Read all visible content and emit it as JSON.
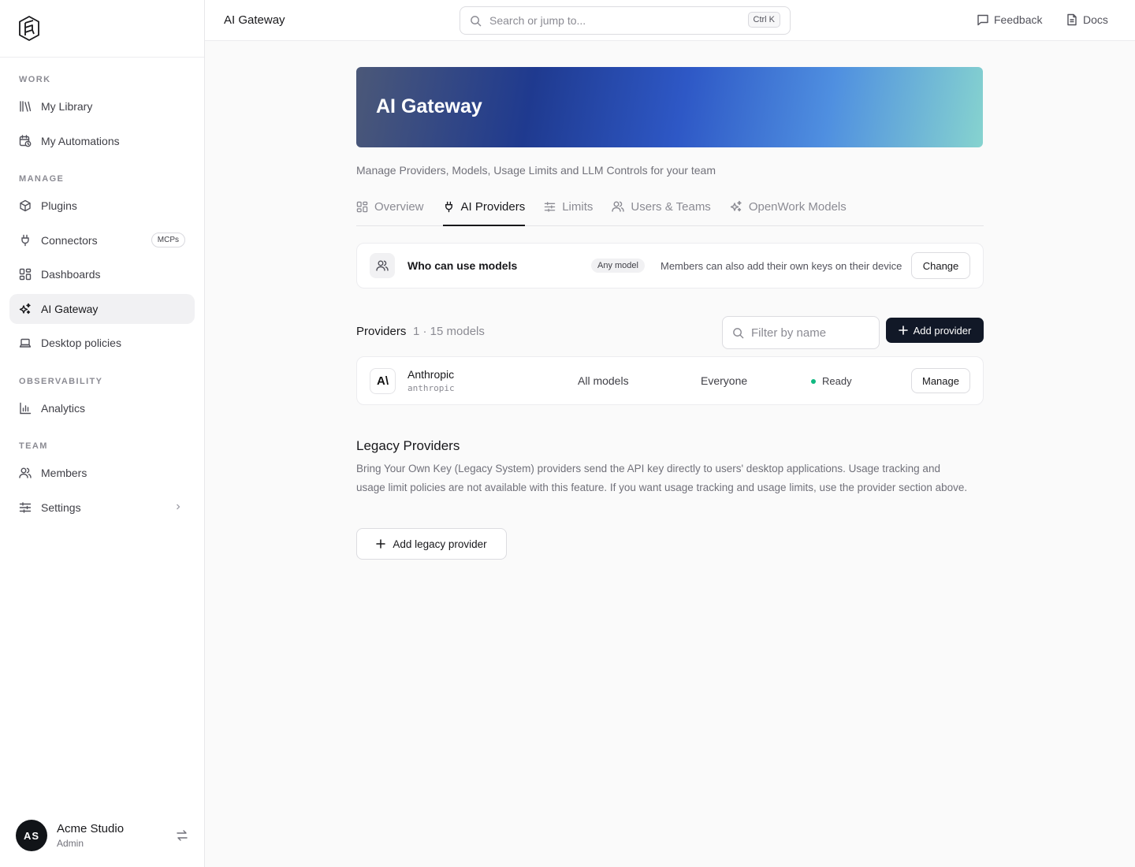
{
  "topbar": {
    "title": "AI Gateway",
    "search_placeholder": "Search or jump to...",
    "shortcut": "Ctrl K",
    "feedback": "Feedback",
    "docs": "Docs"
  },
  "sidebar": {
    "sections": {
      "work": "WORK",
      "manage": "MANAGE",
      "observability": "OBSERVABILITY",
      "team": "TEAM"
    },
    "items": {
      "library": "My Library",
      "automations": "My Automations",
      "plugins": "Plugins",
      "connectors": "Connectors",
      "connectors_badge": "MCPs",
      "dashboards": "Dashboards",
      "ai_gateway": "AI Gateway",
      "desktop_policies": "Desktop policies",
      "analytics": "Analytics",
      "members": "Members",
      "settings": "Settings"
    },
    "user": {
      "initials": "AS",
      "name": "Acme Studio",
      "role": "Admin"
    }
  },
  "main": {
    "banner_title": "AI Gateway",
    "subtitle": "Manage Providers, Models, Usage Limits and LLM Controls for your team",
    "tabs": {
      "overview": "Overview",
      "providers": "AI Providers",
      "limits": "Limits",
      "users_teams": "Users & Teams",
      "openwork_models": "OpenWork Models"
    },
    "access": {
      "title": "Who can use models",
      "pill": "Any model",
      "note": "Members can also add their own keys on their device",
      "change": "Change"
    },
    "providers": {
      "label": "Providers",
      "count": "1 · 15 models",
      "filter_placeholder": "Filter by name",
      "add": "Add provider",
      "rows": [
        {
          "logo": "A\\",
          "name": "Anthropic",
          "slug": "anthropic",
          "models": "All models",
          "who": "Everyone",
          "status": "Ready",
          "action": "Manage"
        }
      ]
    },
    "legacy": {
      "title": "Legacy Providers",
      "description": "Bring Your Own Key (Legacy System) providers send the API key directly to users' desktop applications. Usage tracking and usage limit policies are not available with this feature. If you want usage tracking and usage limits, use the provider section above.",
      "add": "Add legacy provider"
    }
  },
  "colors": {
    "accent": "#111827",
    "status_ready": "#10b981",
    "active_nav_bg": "#f1f1f3"
  },
  "icons": {
    "logo": "hexagon-logo-icon",
    "library": "library-icon",
    "automations": "calendar-clock-icon",
    "plugins": "cube-icon",
    "connectors": "plug-icon",
    "dashboards": "dashboard-grid-icon",
    "ai_gateway": "sparkles-icon",
    "desktop": "laptop-icon",
    "analytics": "bar-chart-icon",
    "members": "users-icon",
    "settings": "sliders-icon"
  }
}
